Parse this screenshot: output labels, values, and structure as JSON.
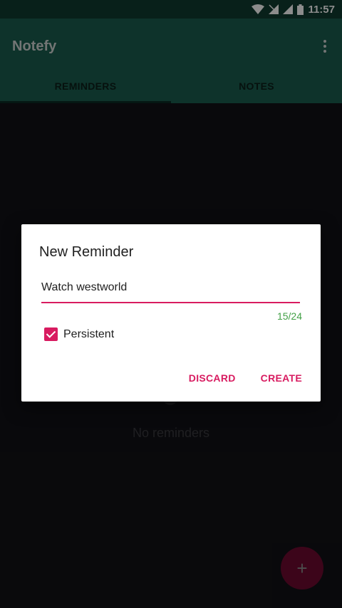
{
  "status_bar": {
    "time": "11:57"
  },
  "app_bar": {
    "title": "Notefy",
    "tabs": [
      {
        "label": "REMINDERS",
        "active": true
      },
      {
        "label": "NOTES",
        "active": false
      }
    ]
  },
  "content": {
    "empty_text": "No reminders"
  },
  "fab": {
    "label": "+"
  },
  "dialog": {
    "title": "New Reminder",
    "input_value": "Watch westworld",
    "counter": "15/24",
    "checkbox_label": "Persistent",
    "checkbox_checked": true,
    "discard_label": "DISCARD",
    "create_label": "CREATE"
  },
  "colors": {
    "primary": "#1b5e4f",
    "primary_dark": "#0f3b31",
    "accent": "#d81b60",
    "counter_ok": "#43a047"
  }
}
